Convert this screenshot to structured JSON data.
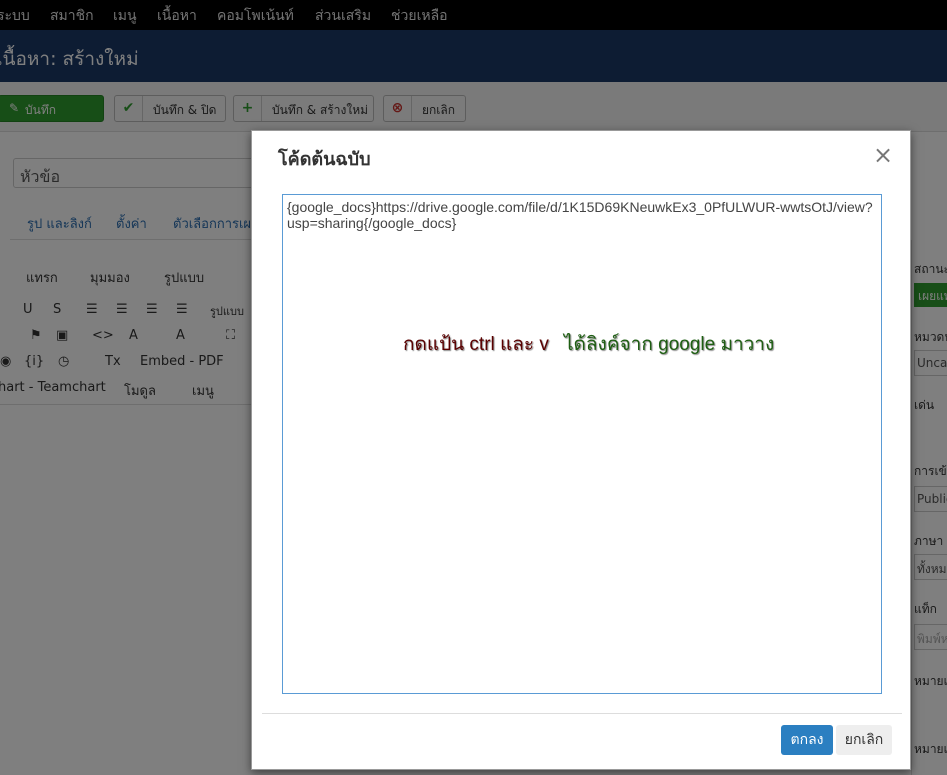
{
  "topmenu": {
    "items": [
      "ระบบ",
      "สมาชิก",
      "เมนู",
      "เนื้อหา",
      "คอมโพเน้นท์",
      "ส่วนเสริม",
      "ช่วยเหลือ"
    ]
  },
  "header": {
    "title": "เนื้อหา: สร้างใหม่"
  },
  "toolbar": {
    "save_label": "บันทึก",
    "save_close_label": "บันทึก & ปิด",
    "save_new_label": "บันทึก & สร้างใหม่",
    "cancel_label": "ยกเลิก"
  },
  "form": {
    "title_placeholder": "หัวข้อ",
    "tabs": [
      "รูป และลิงก์",
      "ตั้งค่า",
      "ตัวเลือกการเผย"
    ]
  },
  "editor": {
    "menus": [
      "แทรก",
      "มุมมอง",
      "รูปแบบ"
    ],
    "format_label": "รูปแบบ",
    "embed_pdf": "Embed - PDF",
    "teamchart": "hart - Teamchart",
    "module": "โมดูล",
    "menu": "เมนู"
  },
  "sidebar": {
    "status": "สถานะ",
    "published": "เผยแพร่",
    "category": "หมวดหมู่",
    "category_value": "Uncategorised",
    "featured": "เด่น",
    "access": "การเข้าถึง",
    "access_value": "Public",
    "language": "ภาษา",
    "language_value": "ทั้งหมด",
    "tags": "แท็ก",
    "tags_placeholder": "พิมพ์หรือเลือก",
    "note": "หมายเหตุ",
    "version_note": "หมายเหตุ"
  },
  "modal": {
    "title": "โค้ดต้นฉบับ",
    "close_icon": "close-icon",
    "source_code": "{google_docs}https://drive.google.com/file/d/1K15D69KNeuwkEx3_0PfULWUR-wwtsOtJ/view?usp=sharing{/google_docs}",
    "annotation_1": "กดแป้น ctrl และ v",
    "annotation_2": "ได้ลิงค์จาก google มาวาง",
    "ok_label": "ตกลง",
    "cancel_label": "ยกเลิก"
  },
  "colors": {
    "topmenu_bg": "#000000",
    "titlebar_bg": "#1a3867",
    "save_green": "#2f9d2e",
    "ok_blue": "#2b7fc1",
    "annotation_red": "#5a0000",
    "annotation_green": "#1e5e12"
  }
}
